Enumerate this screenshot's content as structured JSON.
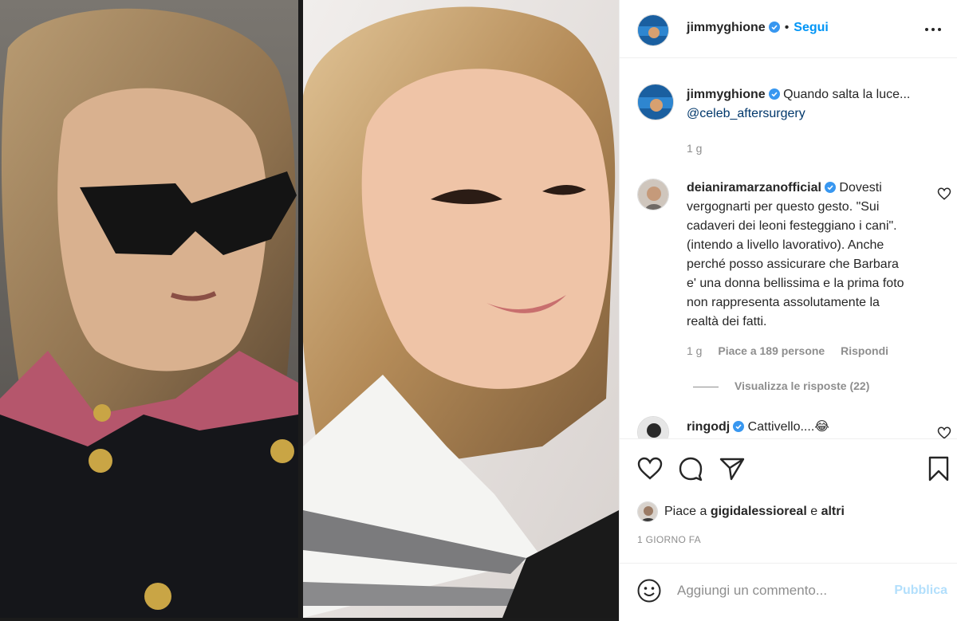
{
  "post": {
    "author": "jimmyghione",
    "follow_label": "Segui",
    "separator": "•"
  },
  "caption": {
    "username": "jimmyghione",
    "text": "Quando salta la luce...",
    "mention": "@celeb_aftersurgery",
    "time": "1 g"
  },
  "comments": [
    {
      "username": "deianiramarzanofficial",
      "text": "Dovesti vergognarti per questo gesto. \"Sui cadaveri dei leoni festeggiano i cani\". (intendo a livello lavorativo). Anche perché posso assicurare che Barbara e' una donna bellissima e la prima foto non rappresenta assolutamente la realtà dei fatti.",
      "time": "1 g",
      "likes": "Piace a 189 persone",
      "reply_label": "Rispondi",
      "view_replies": "Visualizza le risposte (22)"
    },
    {
      "username": "ringodj",
      "text": "Cattivello....😂"
    }
  ],
  "likes": {
    "prefix": "Piace a",
    "user": "gigidalessioreal",
    "conj": "e",
    "others": "altri"
  },
  "timestamp": "1 GIORNO FA",
  "add_comment": {
    "placeholder": "Aggiungi un commento...",
    "publish_label": "Pubblica"
  },
  "icons": {
    "verified": "verified-badge-icon",
    "more": "more-options-icon",
    "like": "heart-icon",
    "comment": "comment-bubble-icon",
    "share": "paper-plane-icon",
    "save": "bookmark-icon",
    "emoji": "smiley-icon"
  },
  "colors": {
    "accent": "#0095f6",
    "verified": "#3897f0",
    "mention": "#00376b",
    "muted": "#8e8e8e",
    "publish_disabled": "#b2dffc"
  }
}
